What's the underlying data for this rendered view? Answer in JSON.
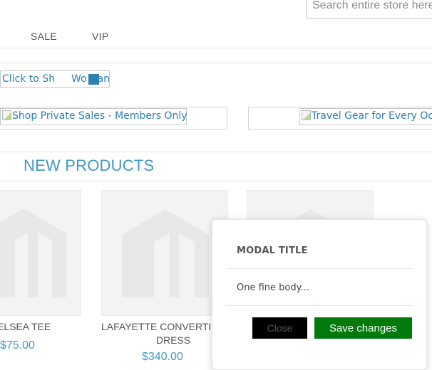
{
  "header": {
    "search": {
      "placeholder": "Search entire store here..."
    }
  },
  "nav": {
    "items": [
      {
        "label": "SALE"
      },
      {
        "label": "VIP"
      }
    ]
  },
  "promo_small": {
    "text_left": "Click to Sh",
    "text_right": "Wo",
    "text_tail": "an"
  },
  "banners": [
    {
      "alt": "Shop Private Sales - Members Only"
    },
    {
      "alt": "Travel Gear for Every Oc"
    }
  ],
  "section": {
    "title": "NEW PRODUCTS"
  },
  "products": [
    {
      "name": "ELSEA TEE",
      "price": "$75.00"
    },
    {
      "name": "LAFAYETTE CONVERTIB",
      "name_line2": "DRESS",
      "price": "$340.00"
    },
    {
      "name": ""
    }
  ],
  "modal": {
    "title": "MODAL TITLE",
    "body": "One fine body...",
    "close_label": "Close",
    "save_label": "Save changes"
  }
}
